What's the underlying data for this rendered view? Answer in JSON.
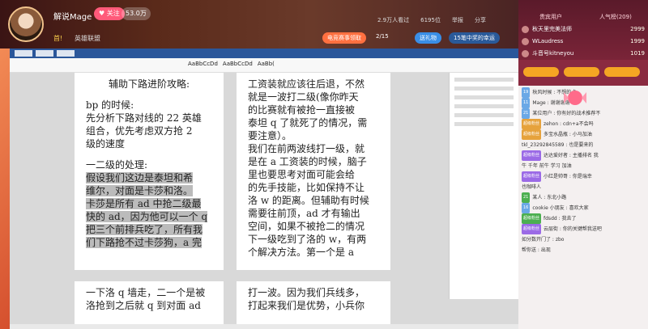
{
  "streamer": {
    "name": "解说Mage",
    "follow_label": "关注",
    "fans_count": "53.0万",
    "rank_text": "首!",
    "hero_link": "英雄联盟"
  },
  "stats": [
    "2.9万人看过",
    "6195位",
    "举报",
    "分享"
  ],
  "controls": {
    "promo": "电竞赛事领取",
    "page": "2/15",
    "pill_a": "送礼物",
    "pill_b": "15笔中奖的幸运"
  },
  "document": {
    "ribbon_styles": [
      "AaBbCcDd",
      "AaBbCcDd",
      "AaBb("
    ],
    "page_left": {
      "heading": "辅助下路进阶攻略:",
      "lines": [
        "bp 的时候:",
        "先分析下路对线的 22 英雄",
        "组合，优先考虑双方抢 2",
        "级的速度",
        "",
        "一二级的处理:"
      ],
      "highlighted": [
        "假设我们这边是泰坦和希",
        "维尔，对面是卡莎和洛。",
        "卡莎是所有 ad 中抢二级最",
        "快的 ad，因为他可以一个 q",
        "把三个前排兵吃了，所有我",
        "们下路抢不过卡莎狗，a 完"
      ]
    },
    "page_right": {
      "lines": [
        "工资装就应该往后退，不然",
        "就是一波打二级(像你昨天",
        "的比赛就有被抢一直接被",
        "泰坦 q 了就死了的情况，需",
        "要注意）。",
        "我们在前两波线打一级，就",
        "是在 a 工资装的时候，脑子",
        "里也要思考对面可能会给",
        "的先手技能，比如保持不让",
        "洛 w 的距离。但辅助有时候",
        "需要往前顶，ad 才有输出",
        "空间，如果不被抢二的情况",
        "下一级吃到了洛的 w，有两",
        "个解决方法。第一个是 a"
      ]
    },
    "page_left_bottom": [
      "一下洛 q 墙走，二一个是被",
      "洛抢到之后就 q 到对面 ad"
    ],
    "page_right_bottom": [
      "打一波。因为我们兵线多，",
      "打起来我们是优势，小兵你"
    ]
  },
  "chat": {
    "tabs": [
      "贵宾用户",
      "人气榜(209)"
    ],
    "top_ranks": [
      {
        "name": "秋天里完美法师",
        "score": "2999"
      },
      {
        "name": "WLaudress",
        "score": "1999"
      },
      {
        "name": "斗音号kitneyou",
        "score": "1019"
      }
    ],
    "messages": [
      {
        "lv": "19",
        "badge": "",
        "text": "秋风时候 : 不想的点"
      },
      {
        "lv": "11",
        "badge": "",
        "text": "Mage : 谢谢谢谢"
      },
      {
        "lv": "21",
        "badge": "",
        "text": "某位用户 : 你有好的战术推荐不"
      },
      {
        "lv": "",
        "badge": "超级粉丝",
        "text": "zehon : cdn+a不会吗"
      },
      {
        "lv": "",
        "badge": "超级粉丝",
        "text": "多宝水晶瓶 : 小马加油"
      },
      {
        "lv": "",
        "badge": "",
        "text": "tkl_23292845589 : 也是要来的"
      },
      {
        "lv": "",
        "badge": "超级粉丝",
        "text": "达达爱好者 : 主播排名 我"
      },
      {
        "lv": "",
        "badge": "",
        "text": "牛 千年 前牛 学习 加油"
      },
      {
        "lv": "",
        "badge": "超级粉丝",
        "text": "小红是帅哥 : 你是瑞幸"
      },
      {
        "lv": "",
        "badge": "",
        "text": "也咖啡人"
      },
      {
        "lv": "21",
        "badge": "",
        "text": "某人 : 东北小路"
      },
      {
        "lv": "16",
        "badge": "",
        "text": "cookie 小朋友 : 喜欢大家"
      },
      {
        "lv": "",
        "badge": "超级粉丝",
        "text": "fdsdd : 我去了"
      },
      {
        "lv": "",
        "badge": "超级粉丝",
        "text": "云层街 : 你的关键帮我送吧"
      },
      {
        "lv": "",
        "badge": "",
        "text": "如分数开门了 : zbo"
      },
      {
        "lv": "",
        "badge": "",
        "text": "帮你送 : 出现"
      }
    ]
  },
  "colors": {
    "accent": "#ff5a7a",
    "chat_bg": "#f4f0f0",
    "header": "#5a2a1a",
    "video_bg": "#e86a3a"
  }
}
